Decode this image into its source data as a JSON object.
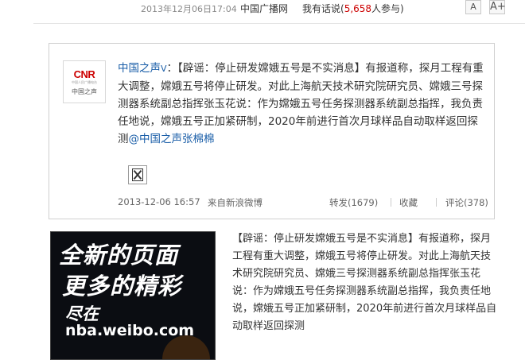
{
  "meta": {
    "date": "2013年12月06日17:04",
    "source": "中国广播网",
    "comment_prefix": "我有话说(",
    "comment_count": "5,658",
    "comment_suffix": "人参与)",
    "font_small": "A",
    "font_large": "A+"
  },
  "weibo": {
    "avatar_logo": "CNR",
    "avatar_sub": "中国人民广播电台",
    "avatar_name": "中国之声",
    "user": "中国之声",
    "vbadge": "V",
    "text": "：【辟谣：停止研发嫦娥五号是不实消息】有报道称，探月工程有重大调整，嫦娥五号将停止研发。对此上海航天技术研究院研究员、嫦娥三号探测器系统副总指挥张玉花说：作为嫦娥五号任务探测器系统副总指挥，我负责任地说，嫦娥五号正加紧研制，2020年前进行首次月球样品自动取样返回探测",
    "mention": "@中国之声张棉棉",
    "time": "2013-12-06 16:57",
    "from": "来自新浪微博",
    "repost": "转发(1679)",
    "collect": "收藏",
    "comments": "评论(378)"
  },
  "ad": {
    "line1": "全新的页面",
    "line2": "更多的精彩",
    "line3": "尽在",
    "line4": "nba.weibo.com"
  },
  "article": {
    "paragraph": "【辟谣：停止研发嫦娥五号是不实消息】有报道称，探月工程有重大调整，嫦娥五号将停止研发。对此上海航天技术研究院研究员、嫦娥三号探测器系统副总指挥张玉花说：作为嫦娥五号任务探测器系统副总指挥，我负责任地说，嫦娥五号正加紧研制，2020年前进行首次月球样品自动取样返回探测"
  }
}
